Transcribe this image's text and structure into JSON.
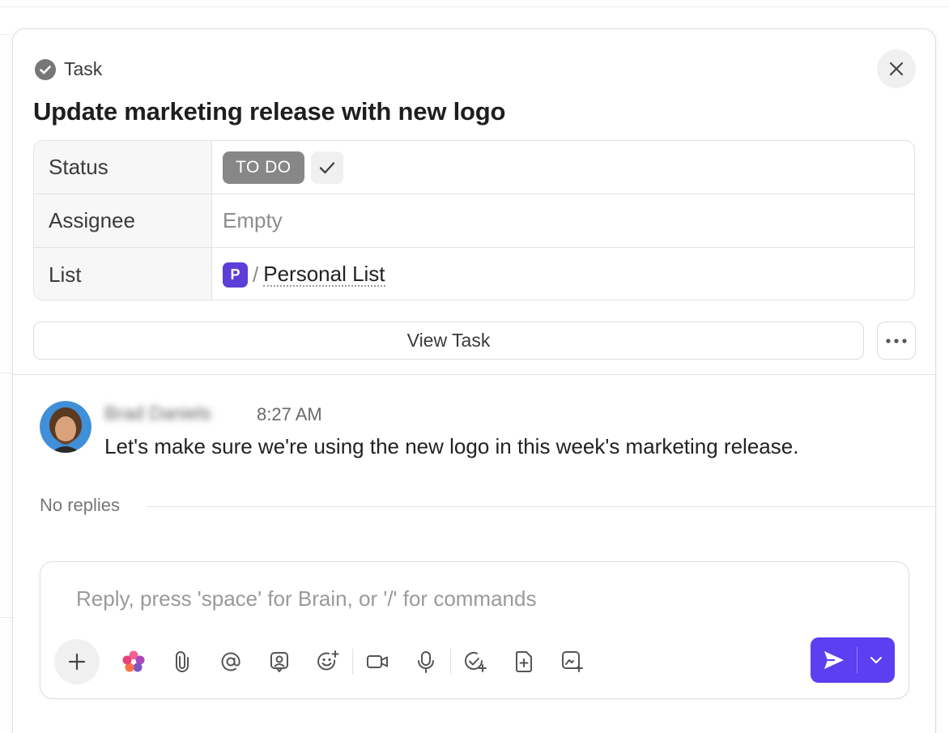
{
  "panel": {
    "type_label": "Task",
    "title": "Update marketing release with new logo"
  },
  "properties": {
    "status_key": "Status",
    "status_value": "TO DO",
    "assignee_key": "Assignee",
    "assignee_value": "Empty",
    "list_key": "List",
    "list_badge": "P",
    "list_separator": "/",
    "list_name": "Personal List"
  },
  "actions": {
    "view_task": "View Task"
  },
  "comment": {
    "author": "Brad Daniels",
    "time": "8:27 AM",
    "text": "Let's make sure we're using the new logo in this week's marketing release."
  },
  "thread": {
    "replies_label": "No replies"
  },
  "composer": {
    "placeholder": "Reply, press 'space' for Brain, or '/' for commands",
    "value": ""
  },
  "colors": {
    "accent": "#5b3ff0",
    "status_pill": "#878787",
    "list_badge": "#5b3fd8"
  },
  "icons": {
    "toolbar": [
      "plus-icon",
      "brain-ai-icon",
      "paperclip-icon",
      "mention-icon",
      "assign-user-icon",
      "emoji-add-icon",
      "video-clip-icon",
      "microphone-icon",
      "create-task-icon",
      "add-doc-icon",
      "ai-image-icon"
    ],
    "send": "send-icon"
  }
}
